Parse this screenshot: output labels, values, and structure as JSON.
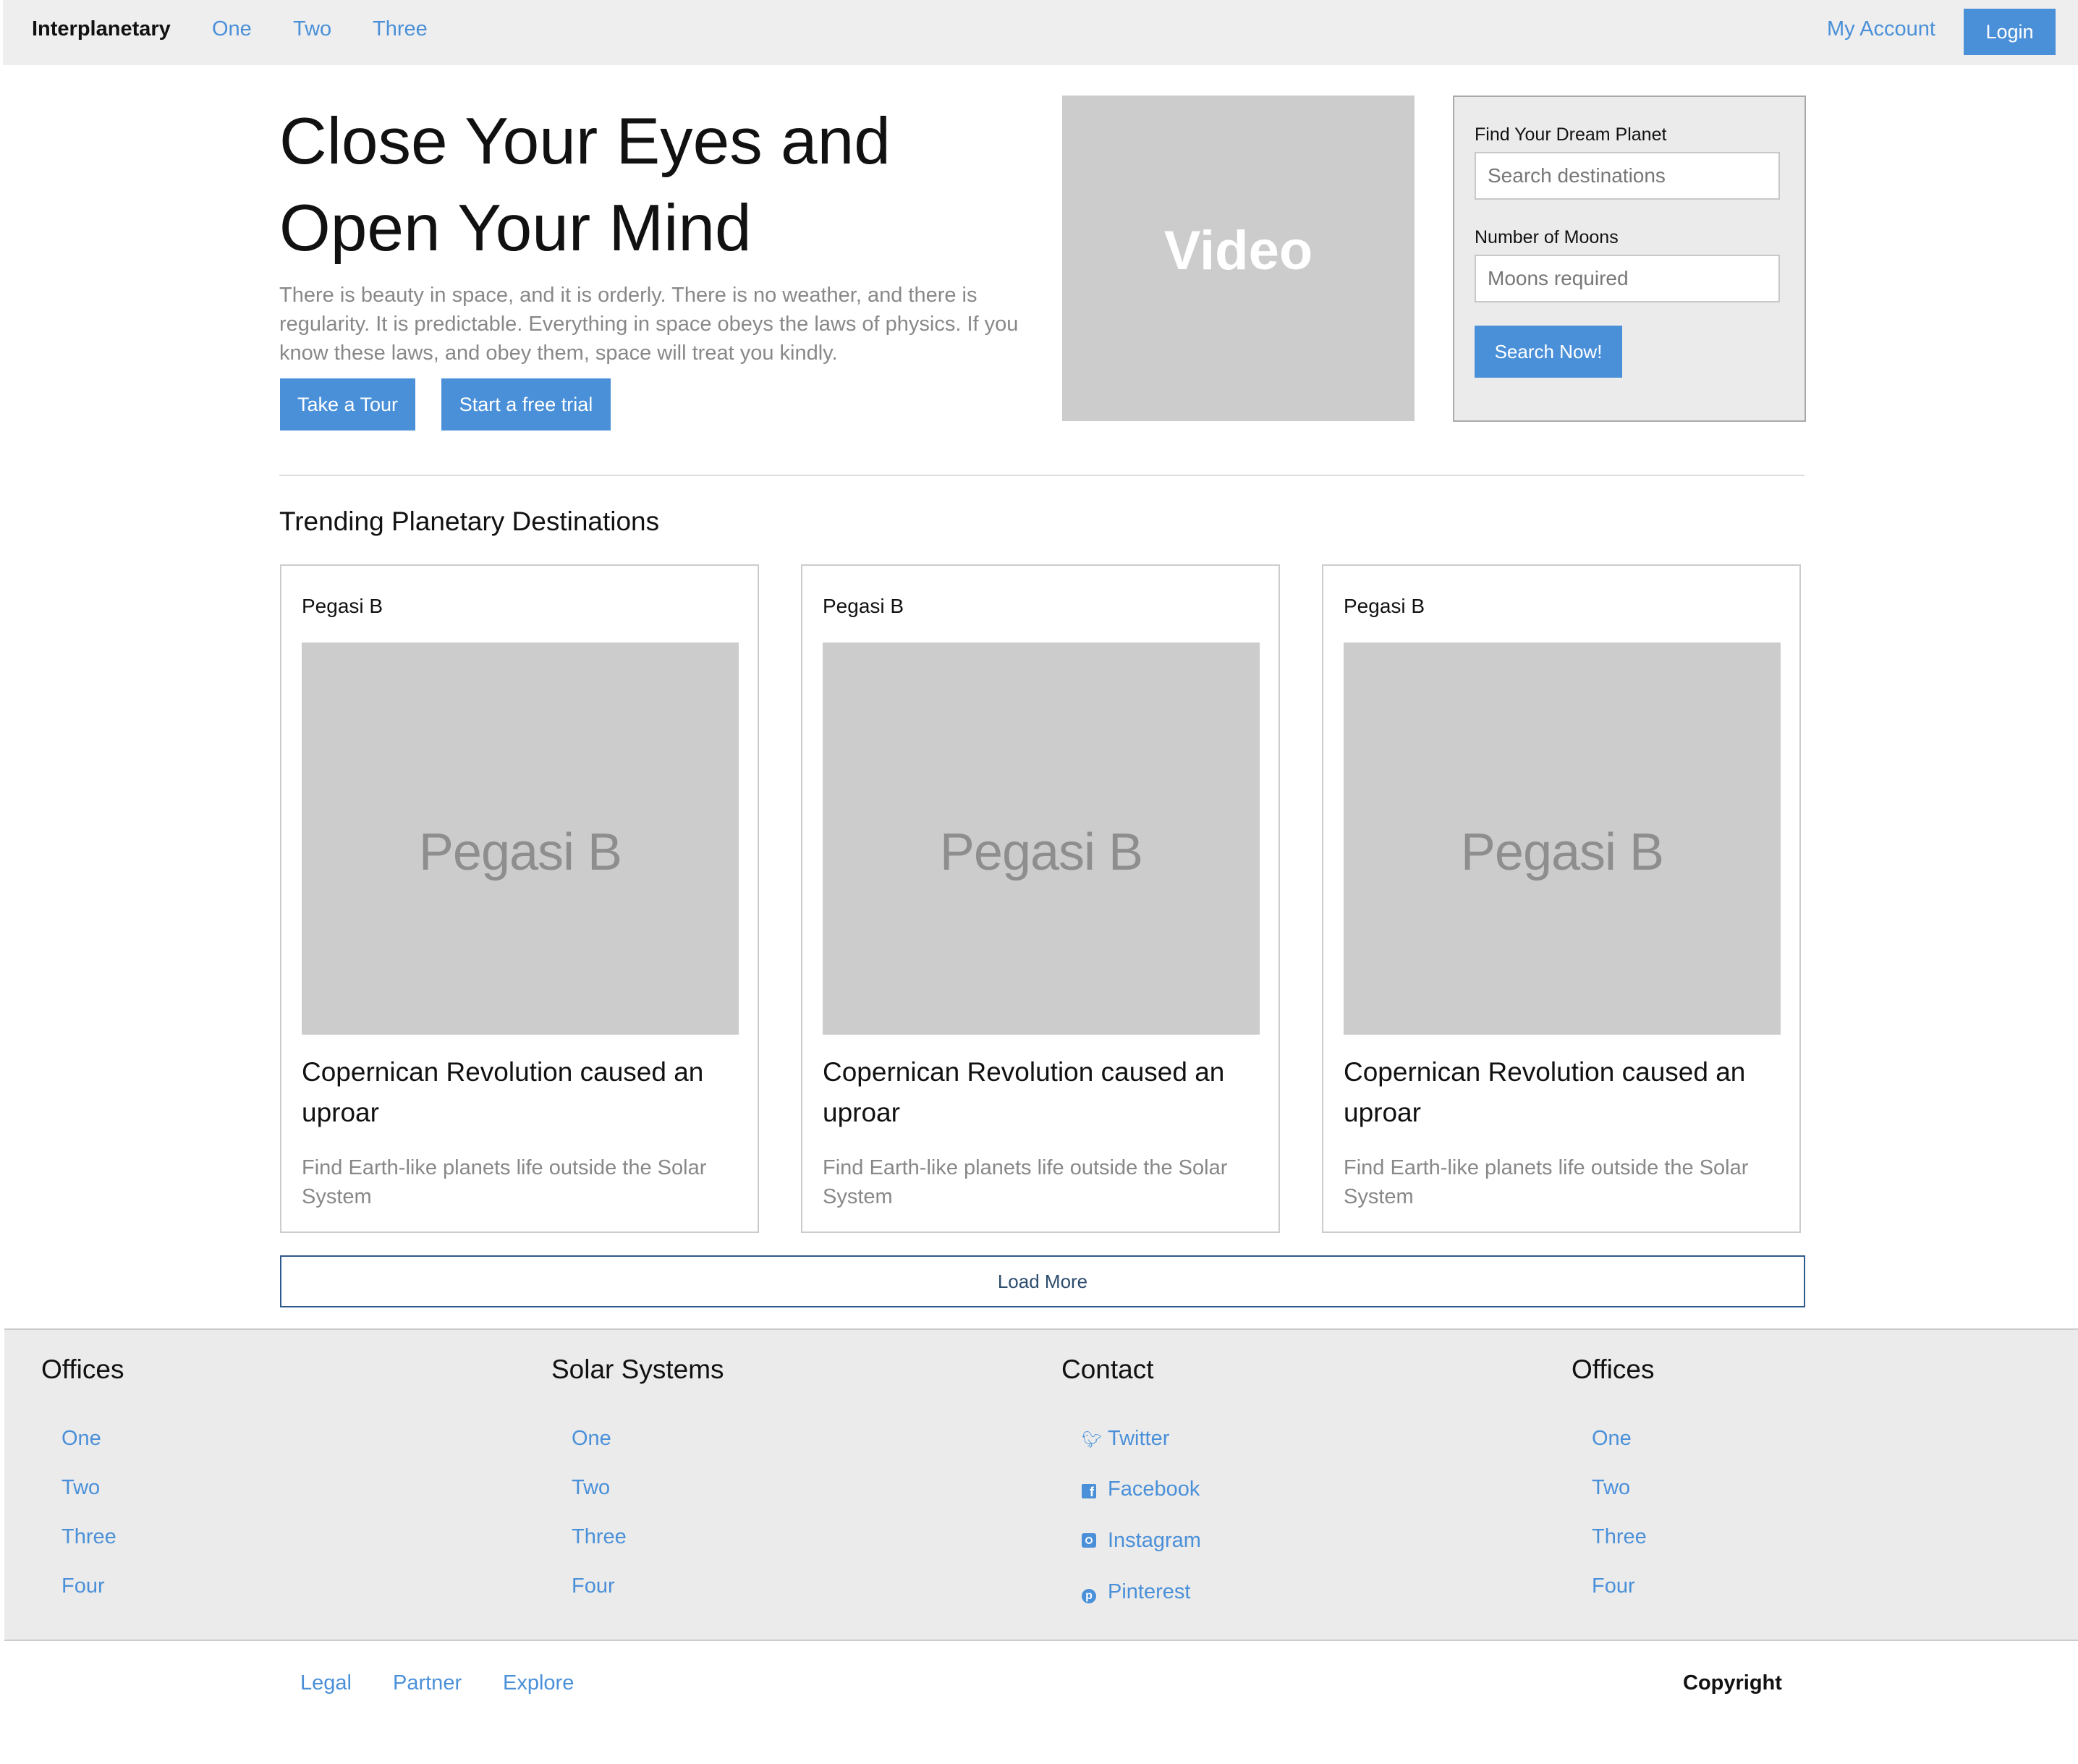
{
  "navbar": {
    "brand": "Interplanetary",
    "links": [
      "One",
      "Two",
      "Three"
    ],
    "account": "My Account",
    "login": "Login"
  },
  "hero": {
    "title": "Close Your Eyes and Open Your Mind",
    "text": "There is beauty in space, and it is orderly. There is no weather, and there is regularity. It is predictable. Everything in space obeys the laws of physics. If you know these laws, and obey them, space will treat you kindly.",
    "tour_button": "Take a Tour",
    "trial_button": "Start a free trial",
    "video_label": "Video"
  },
  "search": {
    "planet_label": "Find Your Dream Planet",
    "planet_placeholder": "Search destinations",
    "moons_label": "Number of Moons",
    "moons_placeholder": "Moons required",
    "button": "Search Now!"
  },
  "trending": {
    "heading": "Trending Planetary Destinations",
    "cards": [
      {
        "label": "Pegasi B",
        "image_text": "Pegasi B",
        "title": "Copernican Revolution caused an uproar",
        "description": "Find Earth-like planets life outside the Solar System"
      },
      {
        "label": "Pegasi B",
        "image_text": "Pegasi B",
        "title": "Copernican Revolution caused an uproar",
        "description": "Find Earth-like planets life outside the Solar System"
      },
      {
        "label": "Pegasi B",
        "image_text": "Pegasi B",
        "title": "Copernican Revolution caused an uproar",
        "description": "Find Earth-like planets life outside the Solar System"
      }
    ],
    "load_more": "Load More"
  },
  "footer": {
    "columns": [
      {
        "heading": "Offices",
        "links": [
          "One",
          "Two",
          "Three",
          "Four"
        ]
      },
      {
        "heading": "Solar Systems",
        "links": [
          "One",
          "Two",
          "Three",
          "Four"
        ]
      },
      {
        "heading": "Contact",
        "links": [
          "Twitter",
          "Facebook",
          "Instagram",
          "Pinterest"
        ],
        "icons": [
          "twitter-icon",
          "facebook-icon",
          "instagram-icon",
          "pinterest-icon"
        ]
      },
      {
        "heading": "Offices",
        "links": [
          "One",
          "Two",
          "Three",
          "Four"
        ]
      }
    ]
  },
  "bottom": {
    "links": [
      "Legal",
      "Partner",
      "Explore"
    ],
    "copyright": "Copyright"
  },
  "colors": {
    "accent": "#4a90d9",
    "placeholder_gray": "#cccccc",
    "footer_bg": "#ebebeb"
  }
}
